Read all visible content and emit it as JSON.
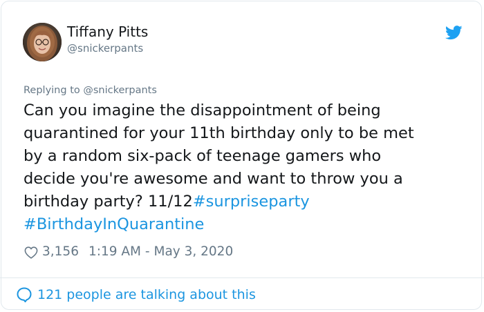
{
  "author": {
    "display_name": "Tiffany Pitts",
    "handle": "@snickerpants"
  },
  "reply": {
    "prefix": "Replying to ",
    "to_handle": "@snickerpants"
  },
  "tweet": {
    "line1": "Can you imagine the disappointment of being",
    "line2": "quarantined for your 11th birthday only to be met",
    "line3": "by a random six-pack of teenage gamers who",
    "line4": "decide you're awesome and want to throw you a",
    "line5_text": "birthday party? 11/12",
    "hashtag1": "#surpriseparty",
    "hashtag2": "#BirthdayInQuarantine"
  },
  "meta": {
    "likes": "3,156",
    "time": "1:19 AM",
    "separator": "-",
    "date": "May 3, 2020"
  },
  "footer": {
    "talking_label": "121 people are talking about this"
  },
  "colors": {
    "link": "#1b95e0",
    "secondary": "#657786",
    "border": "#e1e8ed",
    "text": "#14171a"
  },
  "icons": {
    "logo": "twitter-bird-icon",
    "like": "heart-outline-icon",
    "reply": "speech-bubble-icon"
  }
}
